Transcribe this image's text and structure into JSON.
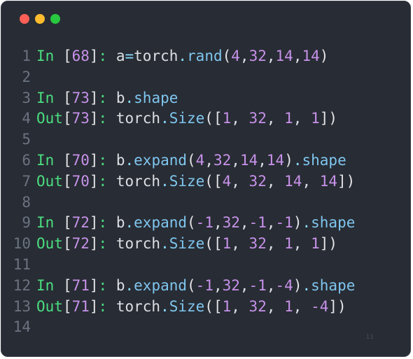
{
  "window": {
    "controls": [
      {
        "name": "close",
        "color": "#ff5f57"
      },
      {
        "name": "minimize",
        "color": "#febc2e"
      },
      {
        "name": "maximize",
        "color": "#28c840"
      }
    ]
  },
  "colors": {
    "prompt": "#4ade80",
    "bracket": "#e4e4e7",
    "number": "#c792ea",
    "ident": "#dcdfe4",
    "op": "#89ddff",
    "func": "#7fc6ef",
    "prop": "#7fc6ef"
  },
  "code_lines": [
    {
      "num": "1",
      "tokens": [
        {
          "t": "In ",
          "k": "prompt"
        },
        {
          "t": "[",
          "k": "bracket"
        },
        {
          "t": "68",
          "k": "number"
        },
        {
          "t": "]",
          "k": "bracket"
        },
        {
          "t": ": ",
          "k": "prompt"
        },
        {
          "t": "a",
          "k": "ident"
        },
        {
          "t": "=",
          "k": "op"
        },
        {
          "t": "torch",
          "k": "ident"
        },
        {
          "t": ".",
          "k": "op"
        },
        {
          "t": "rand",
          "k": "func"
        },
        {
          "t": "(",
          "k": "bracket"
        },
        {
          "t": "4",
          "k": "number"
        },
        {
          "t": ",",
          "k": "ident"
        },
        {
          "t": "32",
          "k": "number"
        },
        {
          "t": ",",
          "k": "ident"
        },
        {
          "t": "14",
          "k": "number"
        },
        {
          "t": ",",
          "k": "ident"
        },
        {
          "t": "14",
          "k": "number"
        },
        {
          "t": ")",
          "k": "bracket"
        }
      ]
    },
    {
      "num": "2",
      "tokens": []
    },
    {
      "num": "3",
      "tokens": [
        {
          "t": "In ",
          "k": "prompt"
        },
        {
          "t": "[",
          "k": "bracket"
        },
        {
          "t": "73",
          "k": "number"
        },
        {
          "t": "]",
          "k": "bracket"
        },
        {
          "t": ": ",
          "k": "prompt"
        },
        {
          "t": "b",
          "k": "ident"
        },
        {
          "t": ".",
          "k": "op"
        },
        {
          "t": "shape",
          "k": "prop"
        }
      ]
    },
    {
      "num": "4",
      "tokens": [
        {
          "t": "Out",
          "k": "prompt"
        },
        {
          "t": "[",
          "k": "bracket"
        },
        {
          "t": "73",
          "k": "number"
        },
        {
          "t": "]",
          "k": "bracket"
        },
        {
          "t": ": ",
          "k": "prompt"
        },
        {
          "t": "torch",
          "k": "ident"
        },
        {
          "t": ".",
          "k": "op"
        },
        {
          "t": "Size",
          "k": "func"
        },
        {
          "t": "([",
          "k": "bracket"
        },
        {
          "t": "1",
          "k": "number"
        },
        {
          "t": ", ",
          "k": "ident"
        },
        {
          "t": "32",
          "k": "number"
        },
        {
          "t": ", ",
          "k": "ident"
        },
        {
          "t": "1",
          "k": "number"
        },
        {
          "t": ", ",
          "k": "ident"
        },
        {
          "t": "1",
          "k": "number"
        },
        {
          "t": "])",
          "k": "bracket"
        }
      ]
    },
    {
      "num": "5",
      "tokens": []
    },
    {
      "num": "6",
      "tokens": [
        {
          "t": "In ",
          "k": "prompt"
        },
        {
          "t": "[",
          "k": "bracket"
        },
        {
          "t": "70",
          "k": "number"
        },
        {
          "t": "]",
          "k": "bracket"
        },
        {
          "t": ": ",
          "k": "prompt"
        },
        {
          "t": "b",
          "k": "ident"
        },
        {
          "t": ".",
          "k": "op"
        },
        {
          "t": "expand",
          "k": "func"
        },
        {
          "t": "(",
          "k": "bracket"
        },
        {
          "t": "4",
          "k": "number"
        },
        {
          "t": ",",
          "k": "ident"
        },
        {
          "t": "32",
          "k": "number"
        },
        {
          "t": ",",
          "k": "ident"
        },
        {
          "t": "14",
          "k": "number"
        },
        {
          "t": ",",
          "k": "ident"
        },
        {
          "t": "14",
          "k": "number"
        },
        {
          "t": ")",
          "k": "bracket"
        },
        {
          "t": ".",
          "k": "op"
        },
        {
          "t": "shape",
          "k": "prop"
        }
      ]
    },
    {
      "num": "7",
      "tokens": [
        {
          "t": "Out",
          "k": "prompt"
        },
        {
          "t": "[",
          "k": "bracket"
        },
        {
          "t": "70",
          "k": "number"
        },
        {
          "t": "]",
          "k": "bracket"
        },
        {
          "t": ": ",
          "k": "prompt"
        },
        {
          "t": "torch",
          "k": "ident"
        },
        {
          "t": ".",
          "k": "op"
        },
        {
          "t": "Size",
          "k": "func"
        },
        {
          "t": "([",
          "k": "bracket"
        },
        {
          "t": "4",
          "k": "number"
        },
        {
          "t": ", ",
          "k": "ident"
        },
        {
          "t": "32",
          "k": "number"
        },
        {
          "t": ", ",
          "k": "ident"
        },
        {
          "t": "14",
          "k": "number"
        },
        {
          "t": ", ",
          "k": "ident"
        },
        {
          "t": "14",
          "k": "number"
        },
        {
          "t": "])",
          "k": "bracket"
        }
      ]
    },
    {
      "num": "8",
      "tokens": []
    },
    {
      "num": "9",
      "tokens": [
        {
          "t": "In ",
          "k": "prompt"
        },
        {
          "t": "[",
          "k": "bracket"
        },
        {
          "t": "72",
          "k": "number"
        },
        {
          "t": "]",
          "k": "bracket"
        },
        {
          "t": ": ",
          "k": "prompt"
        },
        {
          "t": "b",
          "k": "ident"
        },
        {
          "t": ".",
          "k": "op"
        },
        {
          "t": "expand",
          "k": "func"
        },
        {
          "t": "(",
          "k": "bracket"
        },
        {
          "t": "-1",
          "k": "number"
        },
        {
          "t": ",",
          "k": "ident"
        },
        {
          "t": "32",
          "k": "number"
        },
        {
          "t": ",",
          "k": "ident"
        },
        {
          "t": "-1",
          "k": "number"
        },
        {
          "t": ",",
          "k": "ident"
        },
        {
          "t": "-1",
          "k": "number"
        },
        {
          "t": ")",
          "k": "bracket"
        },
        {
          "t": ".",
          "k": "op"
        },
        {
          "t": "shape",
          "k": "prop"
        }
      ]
    },
    {
      "num": "10",
      "tokens": [
        {
          "t": "Out",
          "k": "prompt"
        },
        {
          "t": "[",
          "k": "bracket"
        },
        {
          "t": "72",
          "k": "number"
        },
        {
          "t": "]",
          "k": "bracket"
        },
        {
          "t": ": ",
          "k": "prompt"
        },
        {
          "t": "torch",
          "k": "ident"
        },
        {
          "t": ".",
          "k": "op"
        },
        {
          "t": "Size",
          "k": "func"
        },
        {
          "t": "([",
          "k": "bracket"
        },
        {
          "t": "1",
          "k": "number"
        },
        {
          "t": ", ",
          "k": "ident"
        },
        {
          "t": "32",
          "k": "number"
        },
        {
          "t": ", ",
          "k": "ident"
        },
        {
          "t": "1",
          "k": "number"
        },
        {
          "t": ", ",
          "k": "ident"
        },
        {
          "t": "1",
          "k": "number"
        },
        {
          "t": "])",
          "k": "bracket"
        }
      ]
    },
    {
      "num": "11",
      "tokens": []
    },
    {
      "num": "12",
      "tokens": [
        {
          "t": "In ",
          "k": "prompt"
        },
        {
          "t": "[",
          "k": "bracket"
        },
        {
          "t": "71",
          "k": "number"
        },
        {
          "t": "]",
          "k": "bracket"
        },
        {
          "t": ": ",
          "k": "prompt"
        },
        {
          "t": "b",
          "k": "ident"
        },
        {
          "t": ".",
          "k": "op"
        },
        {
          "t": "expand",
          "k": "func"
        },
        {
          "t": "(",
          "k": "bracket"
        },
        {
          "t": "-1",
          "k": "number"
        },
        {
          "t": ",",
          "k": "ident"
        },
        {
          "t": "32",
          "k": "number"
        },
        {
          "t": ",",
          "k": "ident"
        },
        {
          "t": "-1",
          "k": "number"
        },
        {
          "t": ",",
          "k": "ident"
        },
        {
          "t": "-4",
          "k": "number"
        },
        {
          "t": ")",
          "k": "bracket"
        },
        {
          "t": ".",
          "k": "op"
        },
        {
          "t": "shape",
          "k": "prop"
        }
      ]
    },
    {
      "num": "13",
      "tokens": [
        {
          "t": "Out",
          "k": "prompt"
        },
        {
          "t": "[",
          "k": "bracket"
        },
        {
          "t": "71",
          "k": "number"
        },
        {
          "t": "]",
          "k": "bracket"
        },
        {
          "t": ": ",
          "k": "prompt"
        },
        {
          "t": "torch",
          "k": "ident"
        },
        {
          "t": ".",
          "k": "op"
        },
        {
          "t": "Size",
          "k": "func"
        },
        {
          "t": "([",
          "k": "bracket"
        },
        {
          "t": "1",
          "k": "number"
        },
        {
          "t": ", ",
          "k": "ident"
        },
        {
          "t": "32",
          "k": "number"
        },
        {
          "t": ", ",
          "k": "ident"
        },
        {
          "t": "1",
          "k": "number"
        },
        {
          "t": ", ",
          "k": "ident"
        },
        {
          "t": "-4",
          "k": "number"
        },
        {
          "t": "])",
          "k": "bracket"
        }
      ]
    },
    {
      "num": "14",
      "tokens": []
    }
  ],
  "watermark": "11"
}
